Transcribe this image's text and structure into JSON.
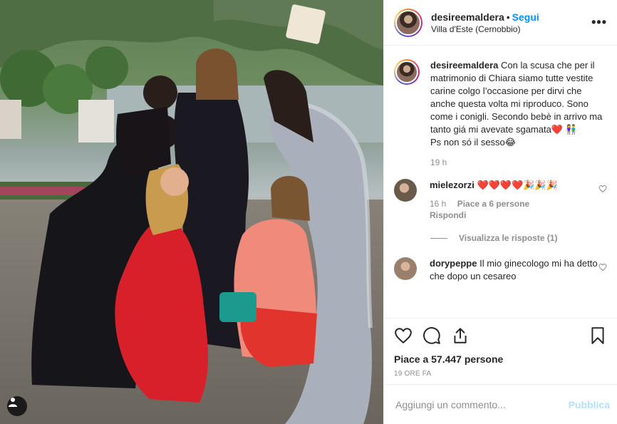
{
  "post": {
    "username": "desireemaldera",
    "follow_label": "Segui",
    "separator": "•",
    "location": "Villa d'Este (Cernobbio)",
    "more_label": "•••"
  },
  "caption": {
    "username": "desireemaldera",
    "text": "Con la scusa che per il matrimonio di Chiara siamo tutte vestite carine colgo l’occasione per dirvi che anche questa volta mi riproduco. Sono come i conigli. Secondo bebè in arrivo ma tanto giá mi avevate sgamata❤️ 👫\nPs non só il sesso😂",
    "time": "19 h"
  },
  "comments": [
    {
      "username": "mielezorzi",
      "text": "❤️❤️❤️❤️🎉🎉🎉",
      "time": "16 h",
      "likes": "Piace a 6 persone",
      "reply": "Rispondi"
    },
    {
      "username": "dorypeppe",
      "text": "Il mio ginecologo mi ha detto che dopo un cesareo"
    }
  ],
  "view_replies": "Visualizza le risposte (1)",
  "likes_text": "Piace a 57.447 persone",
  "post_time": "19 ORE FA",
  "add_comment": {
    "placeholder": "Aggiungi un commento...",
    "publish_label": "Pubblica"
  },
  "icons": {
    "like": "heart-icon",
    "comment": "comment-icon",
    "share": "share-icon",
    "save": "bookmark-icon",
    "user_tags": "user-tag-icon"
  },
  "colors": {
    "accent": "#0095f6",
    "publish_disabled": "#b2dffc",
    "muted": "#8e8e8e",
    "border": "#efefef"
  }
}
